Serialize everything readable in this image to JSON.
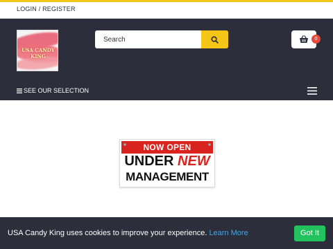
{
  "topbar": {
    "login_label": "LOGIN / REGISTER"
  },
  "header": {
    "logo_text": "USA CANDY KING",
    "search": {
      "placeholder": "Search",
      "value": ""
    },
    "cart": {
      "count": "0"
    }
  },
  "nav": {
    "selection_label": "SEE OUR SELECTION"
  },
  "banner": {
    "line1": "NOW OPEN",
    "line2_a": "UNDER",
    "line2_b": "NEW",
    "line3": "MANAGEMENT"
  },
  "cookie": {
    "message": "USA Candy King uses cookies to improve your experience.",
    "learn_more": "Learn More",
    "accept_label": "Got It"
  },
  "colors": {
    "accent": "#f5c518",
    "header_bg": "#2c2e3b",
    "badge": "#e64a3c",
    "accept": "#22c35e",
    "link": "#4aa3df"
  },
  "icons": [
    "search-icon",
    "basket-icon",
    "hamburger-icon",
    "menu-icon"
  ]
}
